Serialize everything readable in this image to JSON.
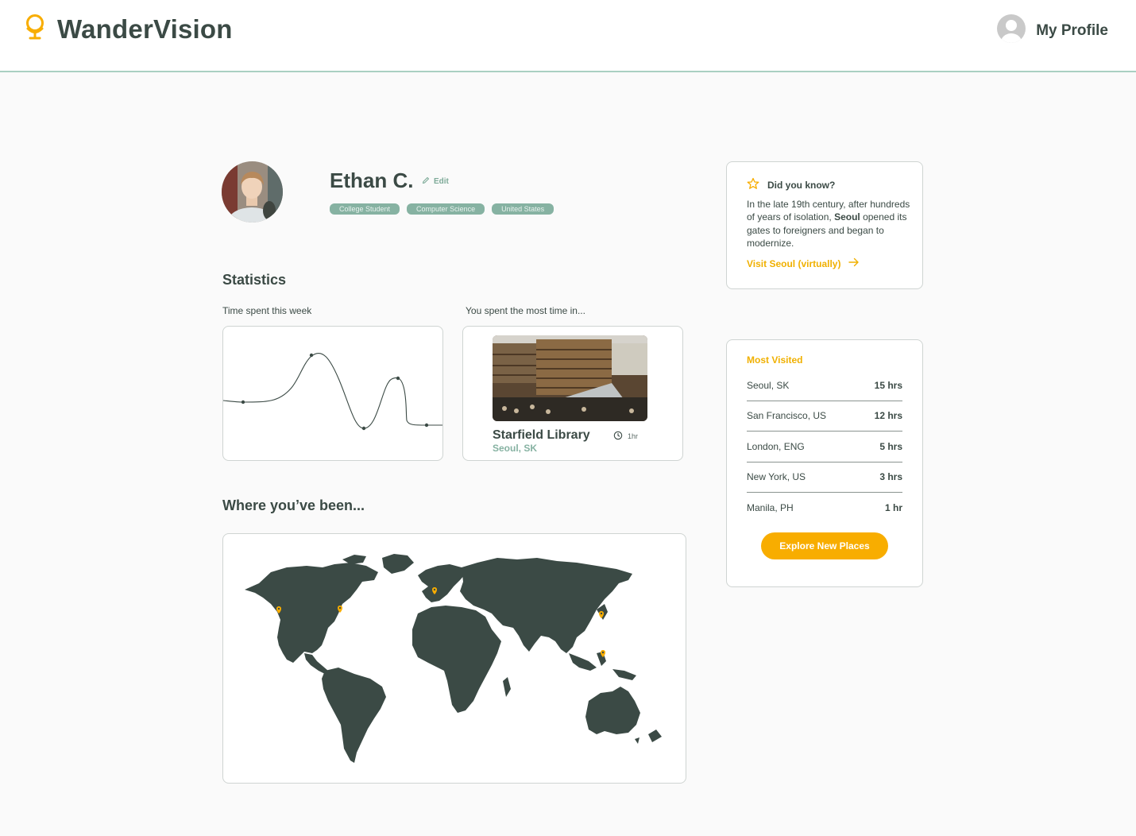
{
  "app": {
    "name": "WanderVision",
    "profile_link": "My Profile"
  },
  "profile": {
    "name": "Ethan C.",
    "edit_label": "Edit",
    "tags": [
      "College Student",
      "Computer Science",
      "United States"
    ]
  },
  "statistics": {
    "title": "Statistics",
    "time_label": "Time spent this week",
    "most_time_label": "You spent the most time in...",
    "top_place": {
      "name": "Starfield Library",
      "location": "Seoul, SK",
      "time": "1hr"
    }
  },
  "map_section": {
    "title": "Where you’ve been...",
    "pins": [
      "San Francisco, US",
      "New York, US",
      "London, ENG",
      "Seoul, SK",
      "Manila, PH"
    ]
  },
  "did_you_know": {
    "title": "Did you know?",
    "text_before": "In the late 19th century, after hundreds of years of isolation, ",
    "highlight": "Seoul",
    "text_after": " opened its gates to foreigners and began to modernize.",
    "link": "Visit Seoul (virtually)"
  },
  "most_visited": {
    "title": "Most Visited",
    "items": [
      {
        "place": "Seoul, SK",
        "hours": "15 hrs"
      },
      {
        "place": "San Francisco, US",
        "hours": "12 hrs"
      },
      {
        "place": "London, ENG",
        "hours": "5 hrs"
      },
      {
        "place": "New York, US",
        "hours": "3 hrs"
      },
      {
        "place": "Manila, PH",
        "hours": "1 hr"
      }
    ],
    "button": "Explore New Places"
  },
  "colors": {
    "accent": "#f8ad00",
    "primary_dark": "#3b4a45",
    "sage": "#86b2a2",
    "header_border": "#a9cfc2"
  },
  "icons": [
    "globe-logo-icon",
    "user-avatar-icon",
    "pencil-icon",
    "clock-icon",
    "star-icon",
    "arrow-right-icon",
    "map-pin-icon"
  ]
}
